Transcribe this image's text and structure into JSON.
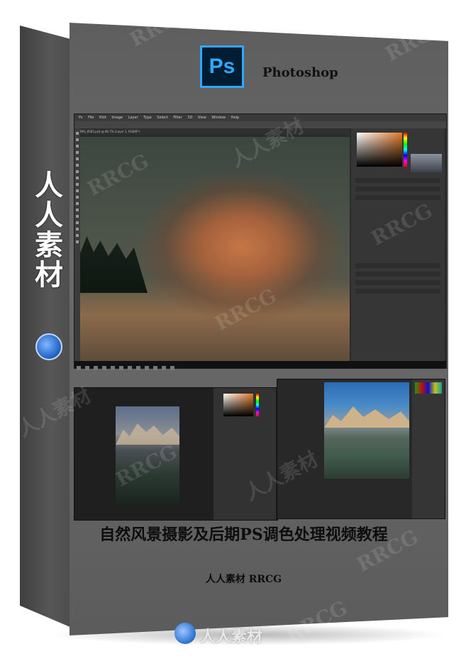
{
  "cover": {
    "app_name": "Photoshop",
    "ps_logo_text": "Ps",
    "spine_text": "人人素材",
    "title": "自然风景摄影及后期PS调色处理视频教程",
    "subtitle": "人人素材 RRCG",
    "bottom_brand": "人人素材",
    "watermark": "RRCG",
    "watermark_cn": "人人素材"
  },
  "ps_menu": [
    "Ps",
    "File",
    "Edit",
    "Image",
    "Layer",
    "Type",
    "Select",
    "Filter",
    "3D",
    "View",
    "Window",
    "Help"
  ],
  "ps_tab": "IMG_8585.psd @ 66.7% (Layer 1, RGB/8*)",
  "colors": {
    "ps_blue": "#31a8ff",
    "ps_bg": "#001d34",
    "box_gray": "#606060"
  }
}
